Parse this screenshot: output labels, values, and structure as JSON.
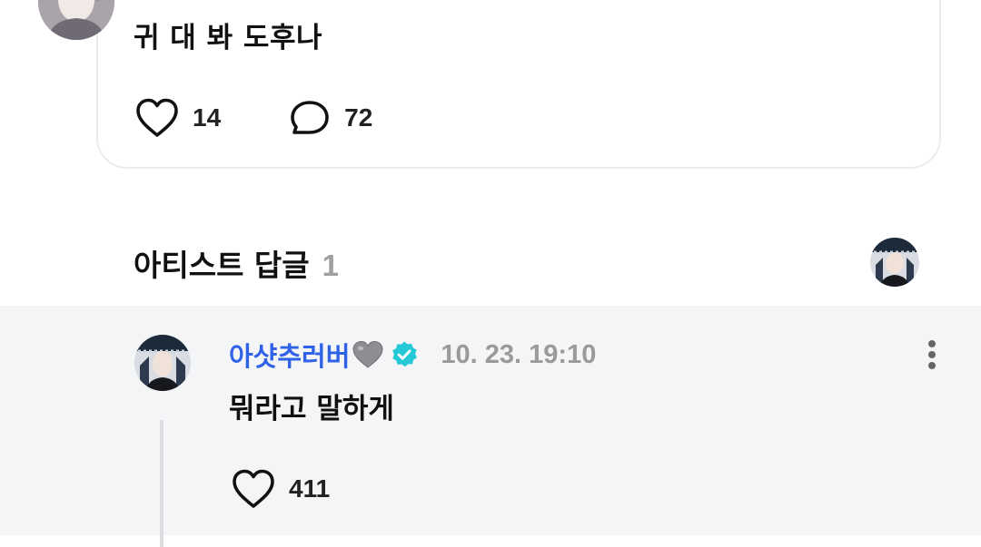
{
  "post": {
    "text": "귀 대 봐 도후나",
    "like_count": "14",
    "comment_count": "72",
    "like_icon": "heart-outline-icon",
    "comment_icon": "speech-bubble-icon"
  },
  "artist_replies": {
    "title": "아티스트 답글",
    "count": "1"
  },
  "reply": {
    "author": "아샷추러버",
    "author_emoji": "grey-heart-emoji",
    "verified_icon": "verified-badge-icon",
    "timestamp": "10. 23. 19:10",
    "text": "뭐라고 말하게",
    "like_count": "411",
    "more_icon": "more-vertical-icon"
  },
  "colors": {
    "author_blue": "#2f62e6",
    "verified_teal": "#25c9d6",
    "muted_gray": "#9a9a9a",
    "reply_background": "#f4f5f7",
    "card_border": "#ececec"
  }
}
